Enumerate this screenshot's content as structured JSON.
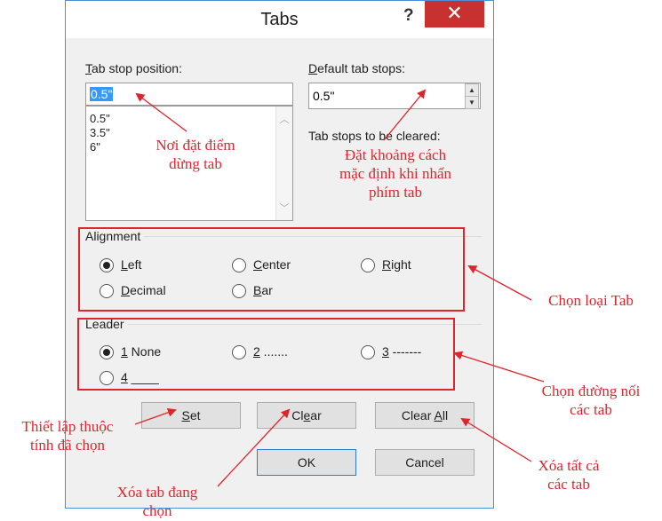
{
  "dialog": {
    "title": "Tabs",
    "help_glyph": "?",
    "close_glyph": "✕"
  },
  "tab_stop": {
    "label_first": "T",
    "label_rest": "ab stop position:",
    "value": "0.5\"",
    "list": [
      "0.5\"",
      "3.5\"",
      "6\""
    ]
  },
  "default_tab": {
    "label_pre": "D",
    "label_rest": "efault tab stops:",
    "value": "0.5\""
  },
  "cleared_label": "Tab stops to be cleared:",
  "alignment": {
    "title": "Alignment",
    "options": [
      {
        "first": "L",
        "rest": "eft",
        "selected": true
      },
      {
        "first": "C",
        "rest": "enter",
        "selected": false
      },
      {
        "first": "R",
        "rest": "ight",
        "selected": false
      },
      {
        "first": "D",
        "rest": "ecimal",
        "selected": false
      },
      {
        "first": "B",
        "rest": "ar",
        "selected": false
      }
    ]
  },
  "leader": {
    "title": "Leader",
    "options": [
      {
        "first": "1",
        "rest": " None",
        "selected": true
      },
      {
        "first": "2",
        "rest": " .......",
        "selected": false
      },
      {
        "first": "3",
        "rest": " -------",
        "selected": false
      },
      {
        "first": "4",
        "rest": " ____",
        "selected": false
      }
    ]
  },
  "buttons": {
    "set": {
      "first": "S",
      "rest": "et"
    },
    "clear": {
      "pre": "Cl",
      "first": "e",
      "rest": "ar"
    },
    "clear_all": {
      "pre": "Clear ",
      "first": "A",
      "rest": "ll"
    },
    "ok": "OK",
    "cancel": "Cancel"
  },
  "annotations": {
    "tab_position": [
      "Nơi đặt điểm",
      "dừng tab"
    ],
    "default_stops": [
      "Đặt khoảng cách",
      "mặc định khi nhấn",
      "phím tab"
    ],
    "alignment": "Chọn loại Tab",
    "leader": [
      "Chọn đường nối",
      "các tab"
    ],
    "set": [
      "Thiết lập thuộc",
      "tính đã chọn"
    ],
    "clear": [
      "Xóa tab đang",
      "chọn"
    ],
    "clear_all": [
      "Xóa tất cả",
      "các tab"
    ]
  },
  "colors": {
    "annotation_red": "#e0242c",
    "selection_blue": "#3399ff",
    "close_red": "#c7312f"
  }
}
